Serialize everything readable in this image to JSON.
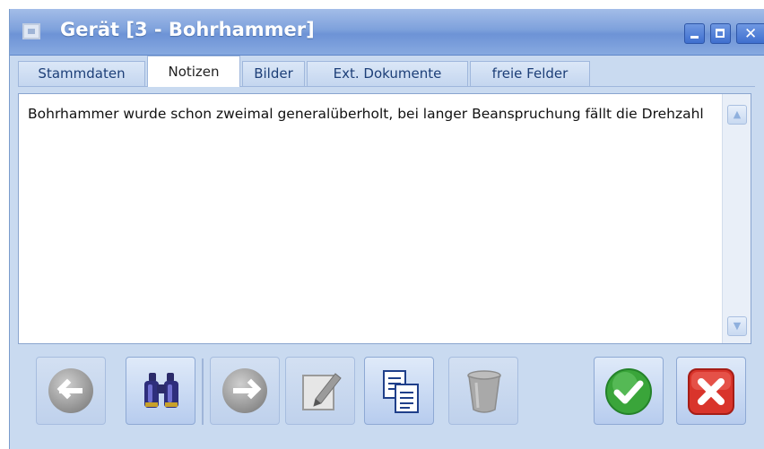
{
  "window": {
    "title": "Gerät [3 - Bohrhammer]",
    "controls": [
      "minimize",
      "maximize",
      "close"
    ]
  },
  "tabs": [
    {
      "label": "Stammdaten",
      "active": false
    },
    {
      "label": "Notizen",
      "active": true
    },
    {
      "label": "Bilder",
      "active": false
    },
    {
      "label": "Ext. Dokumente",
      "active": false
    },
    {
      "label": "freie Felder",
      "active": false
    }
  ],
  "notes": {
    "text": "Bohrhammer wurde schon zweimal generalüberholt, bei langer Beanspruchung fällt die Drehzahl"
  },
  "toolbar": {
    "buttons": [
      {
        "name": "back",
        "icon": "arrow-left-circle-icon",
        "enabled": false
      },
      {
        "name": "search",
        "icon": "binoculars-icon",
        "enabled": true
      },
      {
        "name": "forward",
        "icon": "arrow-right-circle-icon",
        "enabled": false
      },
      {
        "name": "edit",
        "icon": "pencil-icon",
        "enabled": false
      },
      {
        "name": "copy",
        "icon": "copy-documents-icon",
        "enabled": true
      },
      {
        "name": "delete",
        "icon": "trash-icon",
        "enabled": false
      },
      {
        "name": "confirm",
        "icon": "check-icon",
        "enabled": true
      },
      {
        "name": "cancel",
        "icon": "close-x-icon",
        "enabled": true
      }
    ]
  },
  "colors": {
    "title_bar": "#7ea1dc",
    "window_bg": "#c9daf0",
    "confirm_green": "#3aa53a",
    "cancel_red": "#d9342b"
  }
}
